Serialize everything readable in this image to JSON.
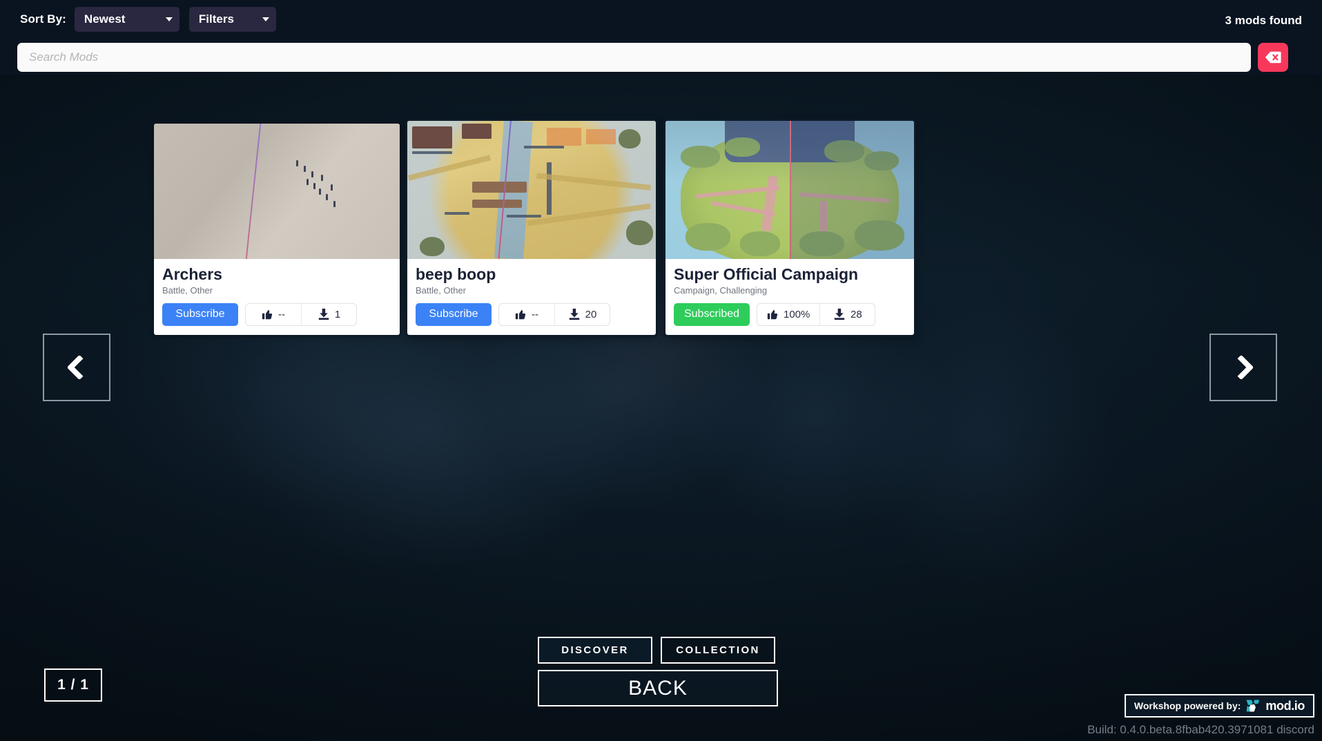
{
  "toolbar": {
    "sort_label": "Sort By:",
    "sort_value": "Newest",
    "filters_label": "Filters",
    "results_count": "3 mods found"
  },
  "search": {
    "placeholder": "Search Mods",
    "value": "",
    "clear_icon": "backspace-icon",
    "clear_color": "#f7385b"
  },
  "mods": [
    {
      "title": "Archers",
      "tags": "Battle, Other",
      "subscribe_label": "Subscribe",
      "subscribed": false,
      "rating": "--",
      "downloads": "1",
      "button_color": "#3b82f6",
      "thumb": "archers-field-thumbnail"
    },
    {
      "title": "beep boop",
      "tags": "Battle, Other",
      "subscribe_label": "Subscribe",
      "subscribed": false,
      "rating": "--",
      "downloads": "20",
      "button_color": "#3b82f6",
      "thumb": "river-battlefield-thumbnail"
    },
    {
      "title": "Super Official Campaign",
      "tags": "Campaign, Challenging",
      "subscribe_label": "Subscribed",
      "subscribed": true,
      "rating": "100%",
      "downloads": "28",
      "button_color": "#2ecc5b",
      "thumb": "green-island-campaign-thumbnail"
    }
  ],
  "pagination": {
    "prev_icon": "chevron-left-icon",
    "next_icon": "chevron-right-icon",
    "page_indicator": "1 / 1"
  },
  "bottom": {
    "discover_label": "DISCOVER",
    "collection_label": "COLLECTION",
    "back_label": "BACK"
  },
  "footer": {
    "powered_by": "Workshop powered by:",
    "brand": "mod.io",
    "brand_icon": "modio-logo-icon",
    "build": "Build: 0.4.0.beta.8fbab420.3971081 discord"
  }
}
